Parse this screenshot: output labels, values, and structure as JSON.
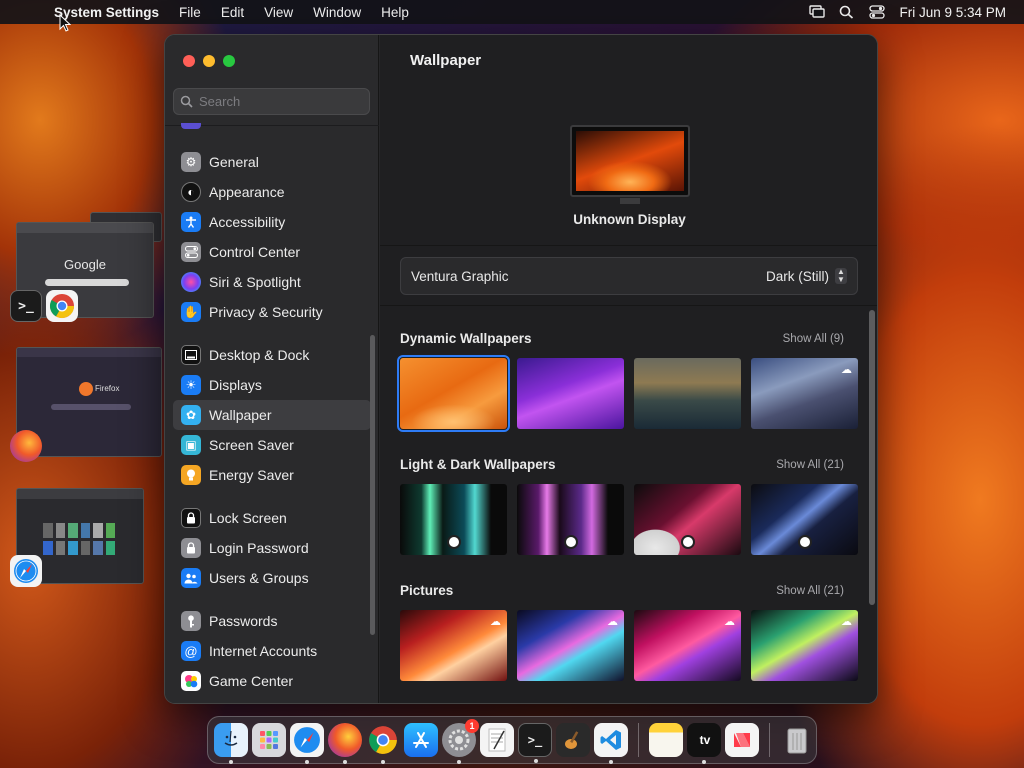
{
  "menubar": {
    "app_name": "System Settings",
    "items": [
      "File",
      "Edit",
      "View",
      "Window",
      "Help"
    ],
    "clock": "Fri Jun 9  5:34 PM"
  },
  "thumbs": {
    "google_text": "Google",
    "firefox_text": "Firefox"
  },
  "window": {
    "search_placeholder": "Search",
    "sidebar": [
      {
        "label": "General",
        "icon": "gear-icon",
        "color": "#8e8e93",
        "glyph": "⚙"
      },
      {
        "label": "Appearance",
        "icon": "appearance-icon",
        "color": "#1c1c1e",
        "glyph": "◐"
      },
      {
        "label": "Accessibility",
        "icon": "accessibility-icon",
        "color": "#1a7cf5",
        "glyph": "♿"
      },
      {
        "label": "Control Center",
        "icon": "control-center-icon",
        "color": "#8e8e93",
        "glyph": "☰"
      },
      {
        "label": "Siri & Spotlight",
        "icon": "siri-icon",
        "color": "#c03ad6",
        "glyph": "●"
      },
      {
        "label": "Privacy & Security",
        "icon": "hand-icon",
        "color": "#1a7cf5",
        "glyph": "✋"
      },
      {
        "label": "Desktop & Dock",
        "icon": "dock-icon",
        "color": "#1c1c1e",
        "glyph": "▭"
      },
      {
        "label": "Displays",
        "icon": "displays-icon",
        "color": "#1a7cf5",
        "glyph": "☀"
      },
      {
        "label": "Wallpaper",
        "icon": "wallpaper-icon",
        "color": "#33b0f0",
        "glyph": "✿"
      },
      {
        "label": "Screen Saver",
        "icon": "screen-saver-icon",
        "color": "#35b6d6",
        "glyph": "▣"
      },
      {
        "label": "Energy Saver",
        "icon": "energy-icon",
        "color": "#f5a623",
        "glyph": "💡"
      },
      {
        "label": "Lock Screen",
        "icon": "lock-icon",
        "color": "#1c1c1e",
        "glyph": "🔒"
      },
      {
        "label": "Login Password",
        "icon": "login-lock-icon",
        "color": "#8e8e93",
        "glyph": "🔒"
      },
      {
        "label": "Users & Groups",
        "icon": "users-icon",
        "color": "#1a7cf5",
        "glyph": "👥"
      },
      {
        "label": "Passwords",
        "icon": "key-icon",
        "color": "#8e8e93",
        "glyph": "🔑"
      },
      {
        "label": "Internet Accounts",
        "icon": "at-icon",
        "color": "#1a7cf5",
        "glyph": "@"
      },
      {
        "label": "Game Center",
        "icon": "game-center-icon",
        "color": "#ffffff",
        "glyph": "●"
      }
    ],
    "main": {
      "title": "Wallpaper",
      "display_name": "Unknown Display",
      "current_wallpaper": "Ventura Graphic",
      "mode": "Dark (Still)",
      "sections": [
        {
          "title": "Dynamic Wallpapers",
          "show_all": "Show All (9)"
        },
        {
          "title": "Light & Dark Wallpapers",
          "show_all": "Show All (21)"
        },
        {
          "title": "Pictures",
          "show_all": "Show All (21)"
        }
      ]
    }
  },
  "dock": {
    "badge_count": "1",
    "tv_label": "tv"
  }
}
